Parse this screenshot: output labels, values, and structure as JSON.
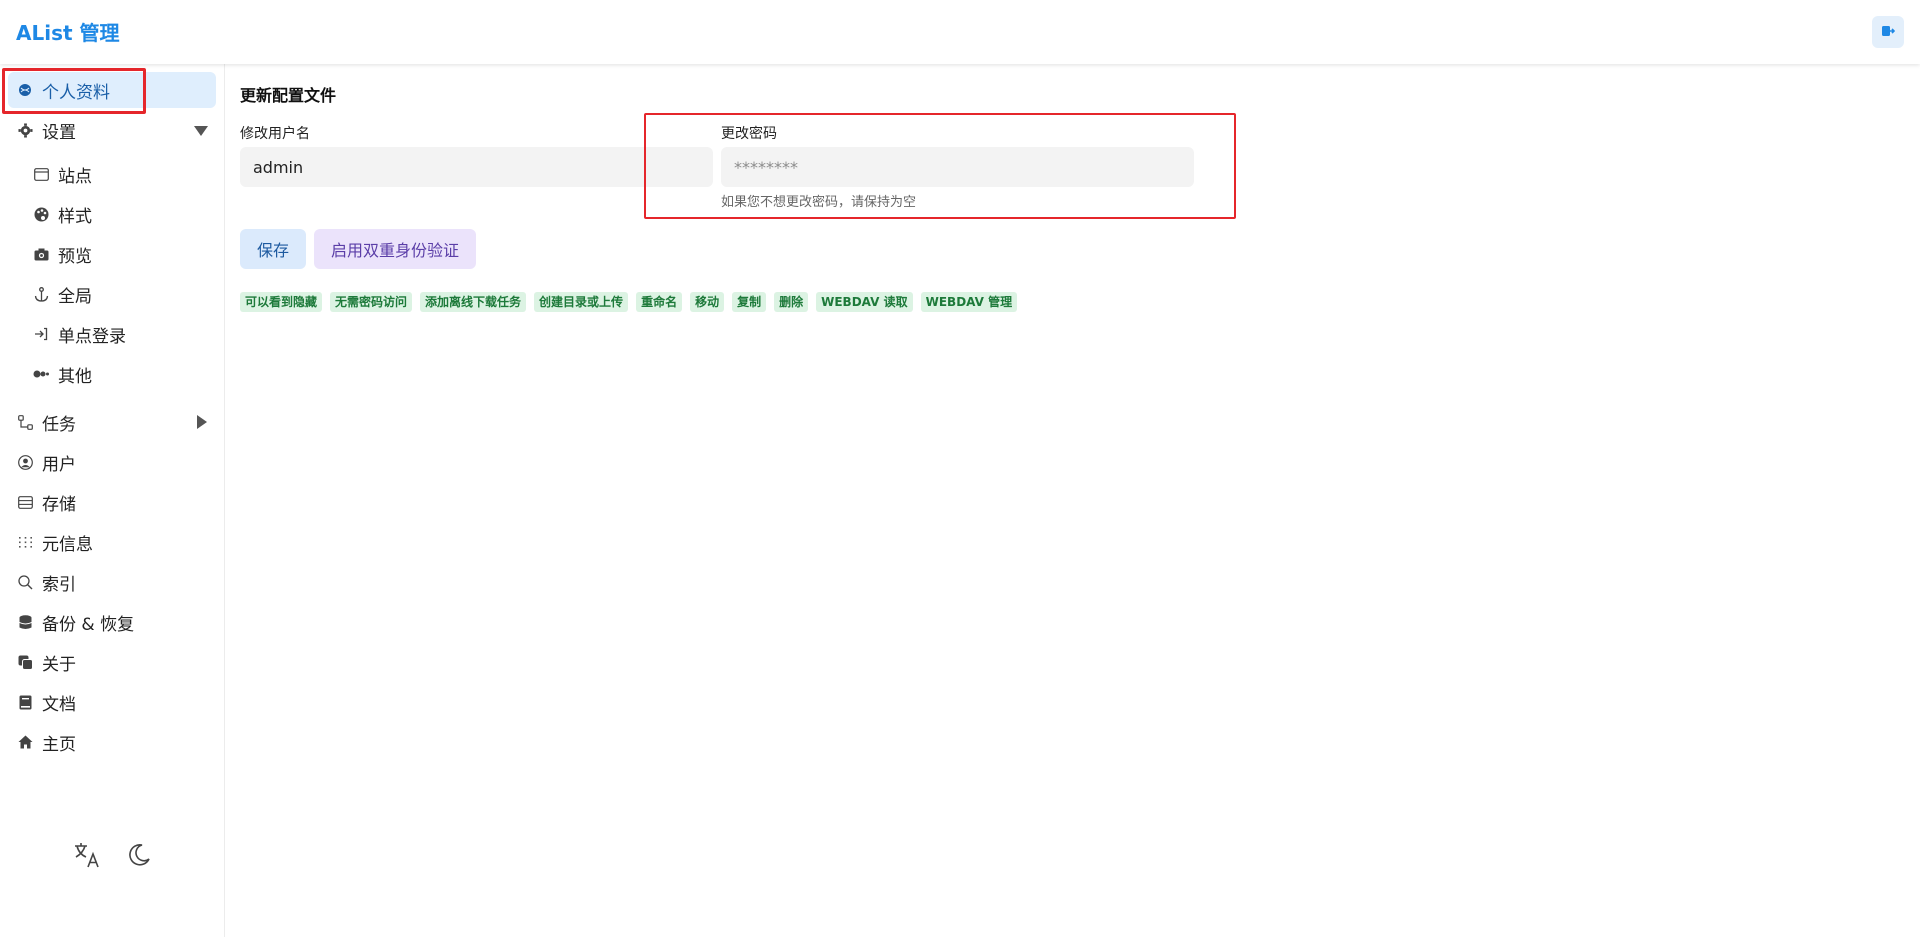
{
  "header": {
    "title": "AList 管理",
    "logout_icon": "logout-icon"
  },
  "sidebar": {
    "items": [
      {
        "label": "个人资料",
        "icon": "profile-icon",
        "active": true
      },
      {
        "label": "设置",
        "icon": "gear-icon",
        "expanded": true
      },
      {
        "label": "站点",
        "icon": "window-icon"
      },
      {
        "label": "样式",
        "icon": "palette-icon"
      },
      {
        "label": "预览",
        "icon": "camera-icon"
      },
      {
        "label": "全局",
        "icon": "anchor-icon"
      },
      {
        "label": "单点登录",
        "icon": "login-icon"
      },
      {
        "label": "其他",
        "icon": "dots-icon"
      },
      {
        "label": "任务",
        "icon": "tasks-icon",
        "expanded": false
      },
      {
        "label": "用户",
        "icon": "user-circle-icon"
      },
      {
        "label": "存储",
        "icon": "storage-icon"
      },
      {
        "label": "元信息",
        "icon": "meta-icon"
      },
      {
        "label": "索引",
        "icon": "search-icon"
      },
      {
        "label": "备份 & 恢复",
        "icon": "database-icon"
      },
      {
        "label": "关于",
        "icon": "about-icon"
      },
      {
        "label": "文档",
        "icon": "book-icon"
      },
      {
        "label": "主页",
        "icon": "home-icon"
      }
    ],
    "bottom_tools": [
      "translate-icon",
      "moon-icon"
    ]
  },
  "main": {
    "section_title": "更新配置文件",
    "username_label": "修改用户名",
    "username_value": "admin",
    "password_label": "更改密码",
    "password_placeholder": "********",
    "password_help": "如果您不想更改密码，请保持为空",
    "save_label": "保存",
    "twofa_label": "启用双重身份验证",
    "permissions": [
      "可以看到隐藏",
      "无需密码访问",
      "添加离线下载任务",
      "创建目录或上传",
      "重命名",
      "移动",
      "复制",
      "删除",
      "WEBDAV 读取",
      "WEBDAV 管理"
    ]
  },
  "colors": {
    "accent": "#1e88e5",
    "active_bg": "#dfeefd",
    "highlight_box": "#e5262b",
    "permission_bg": "#dcf3e3",
    "permission_text": "#1d7a3a"
  }
}
